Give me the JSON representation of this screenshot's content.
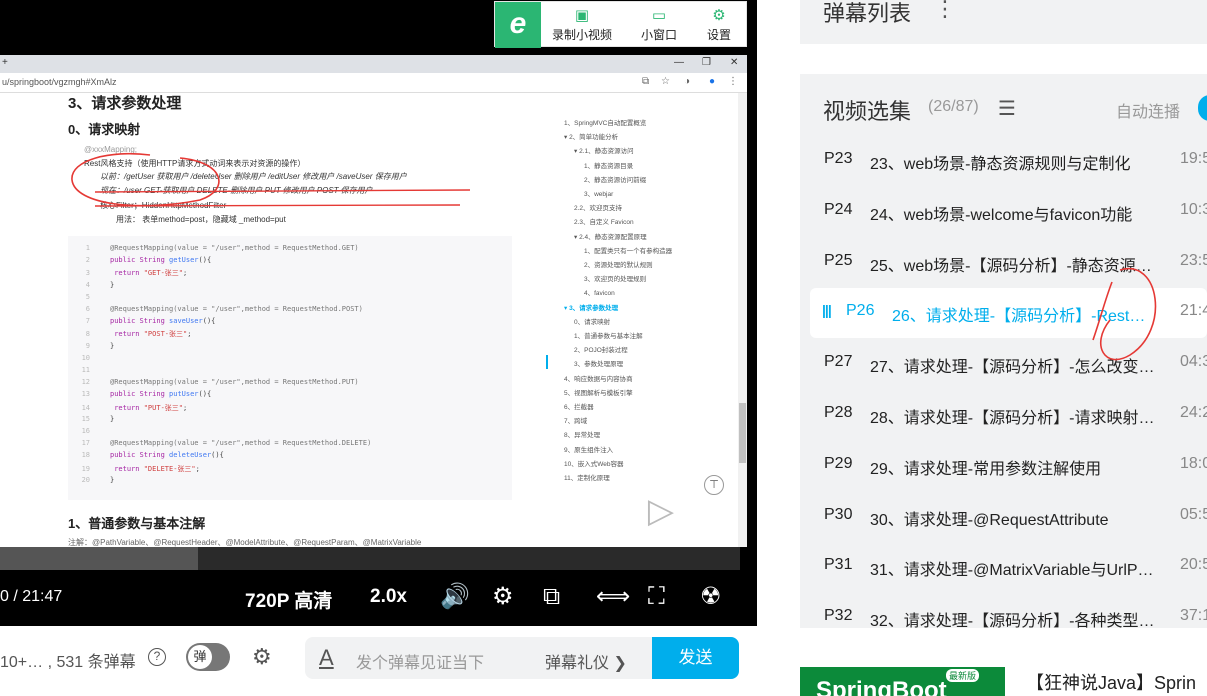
{
  "browser": {
    "url": "u/springboot/vgzmgh#XmAlz",
    "win_tab": "+"
  },
  "pip": {
    "logo": "e",
    "record_label": "录制小视频",
    "mini_label": "小窗口",
    "settings_label": "设置"
  },
  "doc": {
    "h1": "3、请求参数处理",
    "h2": "0、请求映射",
    "bullets": [
      "@xxxMapping;",
      "Rest风格支持（使用HTTP请求方式动词来表示对资源的操作）",
      "以前：/getUser   获取用户     /deleteUser 删除用户    /editUser  修改用户       /saveUser 保存用户",
      "现在：/user    GET-获取用户    DELETE-删除用户     PUT-修改用户      POST-保存用户",
      "核心Filter；HiddenHttpMethodFilter",
      "用法：  表单method=post，隐藏域 _method=put"
    ],
    "code_lines": [
      {
        "n": "1",
        "a": "@RequestMapping(value = \"/user\",method = RequestMethod.GET)"
      },
      {
        "n": "2",
        "k": "public String ",
        "f": "getUser",
        "p": "(){"
      },
      {
        "n": "3",
        "k": "    return ",
        "s": "\"GET-张三\"",
        "p": ";"
      },
      {
        "n": "4",
        "p": "}"
      },
      {
        "n": "5"
      },
      {
        "n": "6",
        "a": "@RequestMapping(value = \"/user\",method = RequestMethod.POST)"
      },
      {
        "n": "7",
        "k": "public String ",
        "f": "saveUser",
        "p": "(){"
      },
      {
        "n": "8",
        "k": "    return ",
        "s": "\"POST-张三\"",
        "p": ";"
      },
      {
        "n": "9",
        "p": "}"
      },
      {
        "n": "10"
      },
      {
        "n": "11"
      },
      {
        "n": "12",
        "a": "@RequestMapping(value = \"/user\",method = RequestMethod.PUT)"
      },
      {
        "n": "13",
        "k": "public String ",
        "f": "putUser",
        "p": "(){"
      },
      {
        "n": "14",
        "k": "    return ",
        "s": "\"PUT-张三\"",
        "p": ";"
      },
      {
        "n": "15",
        "p": "}"
      },
      {
        "n": "16"
      },
      {
        "n": "17",
        "a": "@RequestMapping(value = \"/user\",method = RequestMethod.DELETE)"
      },
      {
        "n": "18",
        "k": "public String ",
        "f": "deleteUser",
        "p": "(){"
      },
      {
        "n": "19",
        "k": "    return ",
        "s": "\"DELETE-张三\"",
        "p": ";"
      },
      {
        "n": "20",
        "p": "}"
      }
    ],
    "h2b": "1、普通参数与基本注解",
    "note": "注解：@PathVariable、@RequestHeader、@ModelAttribute、@RequestParam、@MatrixVariable"
  },
  "toc": [
    {
      "text": "1、SpringMVC自动配置概览",
      "indent": 0
    },
    {
      "text": "▾ 2、简单功能分析",
      "indent": 0
    },
    {
      "text": "▾ 2.1、静态资源访问",
      "indent": 1
    },
    {
      "text": "1、静态资源目录",
      "indent": 2
    },
    {
      "text": "2、静态资源访问前缀",
      "indent": 2
    },
    {
      "text": "3、webjar",
      "indent": 2
    },
    {
      "text": "2.2、欢迎页支持",
      "indent": 1
    },
    {
      "text": "2.3、自定义 Favicon",
      "indent": 1
    },
    {
      "text": "▾ 2.4、静态资源配置原理",
      "indent": 1
    },
    {
      "text": "1、配置类只有一个有参构造器",
      "indent": 2
    },
    {
      "text": "2、资源处理的默认规则",
      "indent": 2
    },
    {
      "text": "3、欢迎页的处理规则",
      "indent": 2
    },
    {
      "text": "4、favicon",
      "indent": 2
    },
    {
      "text": "▾ 3、请求参数处理",
      "indent": 0,
      "active": true
    },
    {
      "text": "0、请求映射",
      "indent": 1
    },
    {
      "text": "1、普通参数与基本注解",
      "indent": 1
    },
    {
      "text": "2、POJO封装过程",
      "indent": 1
    },
    {
      "text": "3、参数处理原理",
      "indent": 1
    },
    {
      "text": "4、响应数据与内容协商",
      "indent": 0
    },
    {
      "text": "5、视图解析与模板引擎",
      "indent": 0
    },
    {
      "text": "6、拦截器",
      "indent": 0
    },
    {
      "text": "7、跨域",
      "indent": 0
    },
    {
      "text": "8、异常处理",
      "indent": 0
    },
    {
      "text": "9、原生组件注入",
      "indent": 0
    },
    {
      "text": "10、嵌入式Web容器",
      "indent": 0
    },
    {
      "text": "11、定制化原理",
      "indent": 0
    }
  ],
  "player": {
    "time": "0 / 21:47",
    "quality": "720P 高清",
    "speed": "2.0x",
    "progress": 0.0
  },
  "danmaku": {
    "count_text": "10+… , 531 条弹幕",
    "help": "?",
    "toggle": "弹",
    "placeholder": "发个弹幕见证当下",
    "etiquette": "弹幕礼仪 ❯",
    "send": "发送",
    "input_icon": "A"
  },
  "right": {
    "danmaku_list_title": "弹幕列表",
    "more": "⋮",
    "playlist_title": "视频选集",
    "playlist_count": "(26/87)",
    "autoplay": "自动连播",
    "episodes": [
      {
        "code": "P23",
        "title": "23、web场景-静态资源规则与定制化",
        "dur": "19:5"
      },
      {
        "code": "P24",
        "title": "24、web场景-welcome与favicon功能",
        "dur": "10:3"
      },
      {
        "code": "P25",
        "title": "25、web场景-【源码分析】-静态资源…",
        "dur": "23:5"
      },
      {
        "code": "P26",
        "title": "26、请求处理-【源码分析】-Rest…",
        "dur": "21:4",
        "current": true
      },
      {
        "code": "P27",
        "title": "27、请求处理-【源码分析】-怎么改变…",
        "dur": "04:3"
      },
      {
        "code": "P28",
        "title": "28、请求处理-【源码分析】-请求映射…",
        "dur": "24:2"
      },
      {
        "code": "P29",
        "title": "29、请求处理-常用参数注解使用",
        "dur": "18:0"
      },
      {
        "code": "P30",
        "title": "30、请求处理-@RequestAttribute",
        "dur": "05:5"
      },
      {
        "code": "P31",
        "title": "31、请求处理-@MatrixVariable与UrlP…",
        "dur": "20:5"
      },
      {
        "code": "P32",
        "title": "32、请求处理-【源码分析】-各种类型…",
        "dur": "37:1"
      }
    ],
    "reco_thumb_text": "SpringBoot",
    "reco_badge": "最新版",
    "reco_title": "【狂神说Java】Sprin"
  }
}
